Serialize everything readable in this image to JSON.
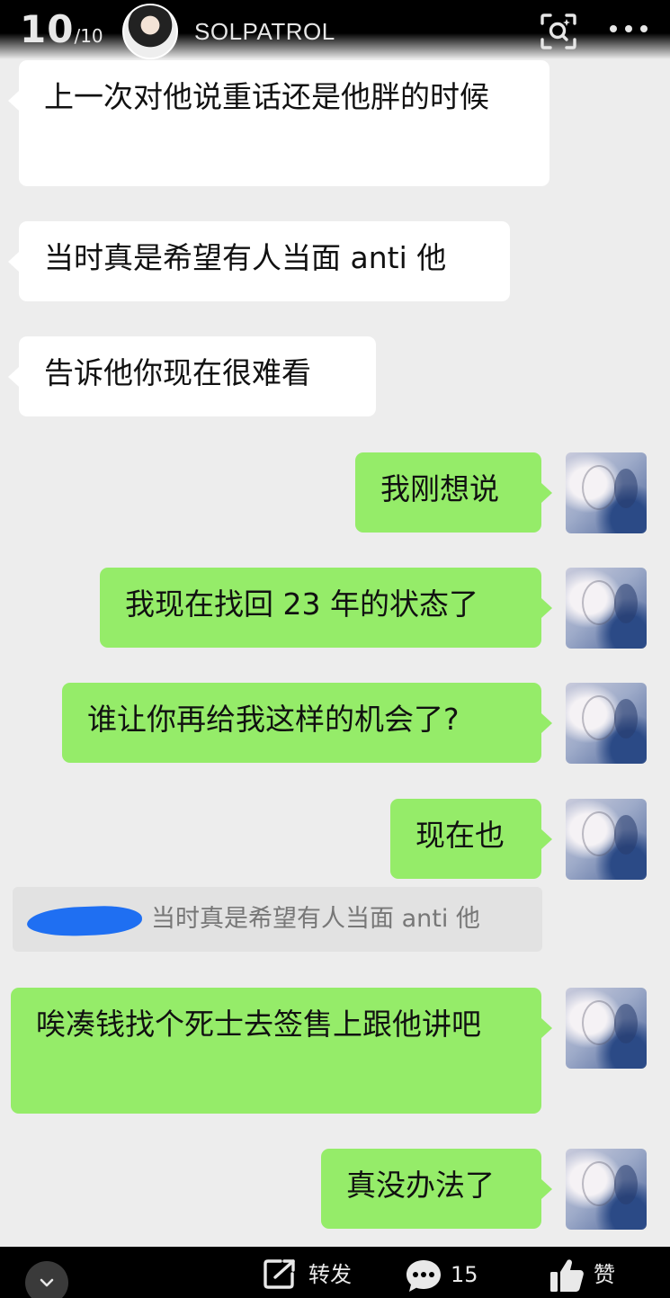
{
  "header": {
    "page_current": "10",
    "page_total": "/10",
    "username": "SOLPATROL",
    "scan_icon": "scan-search-icon",
    "more_icon": "more-dots-icon"
  },
  "messages": [
    {
      "side": "in",
      "text": "上一次对他说重话还是他胖的时候"
    },
    {
      "side": "in",
      "text": "当时真是希望有人当面 anti 他"
    },
    {
      "side": "in",
      "text": "告诉他你现在很难看"
    },
    {
      "side": "out",
      "text": "我刚想说"
    },
    {
      "side": "out",
      "text": "我现在找回 23 年的状态了"
    },
    {
      "side": "out",
      "text": "谁让你再给我这样的机会了?"
    },
    {
      "side": "out",
      "text": "现在也"
    },
    {
      "side": "out",
      "text": "唉凑钱找个死士去签售上跟他讲吧"
    },
    {
      "side": "out",
      "text": "真没办法了"
    }
  ],
  "quote": {
    "text": "当时真是希望有人当面 anti 他"
  },
  "footer": {
    "forward_label": "转发",
    "comment_count": "15",
    "like_label": "赞"
  },
  "colors": {
    "background": "#ededed",
    "bubble_out": "#95ec69",
    "bubble_in": "#ffffff",
    "quote_blob": "#1f6ff2"
  }
}
